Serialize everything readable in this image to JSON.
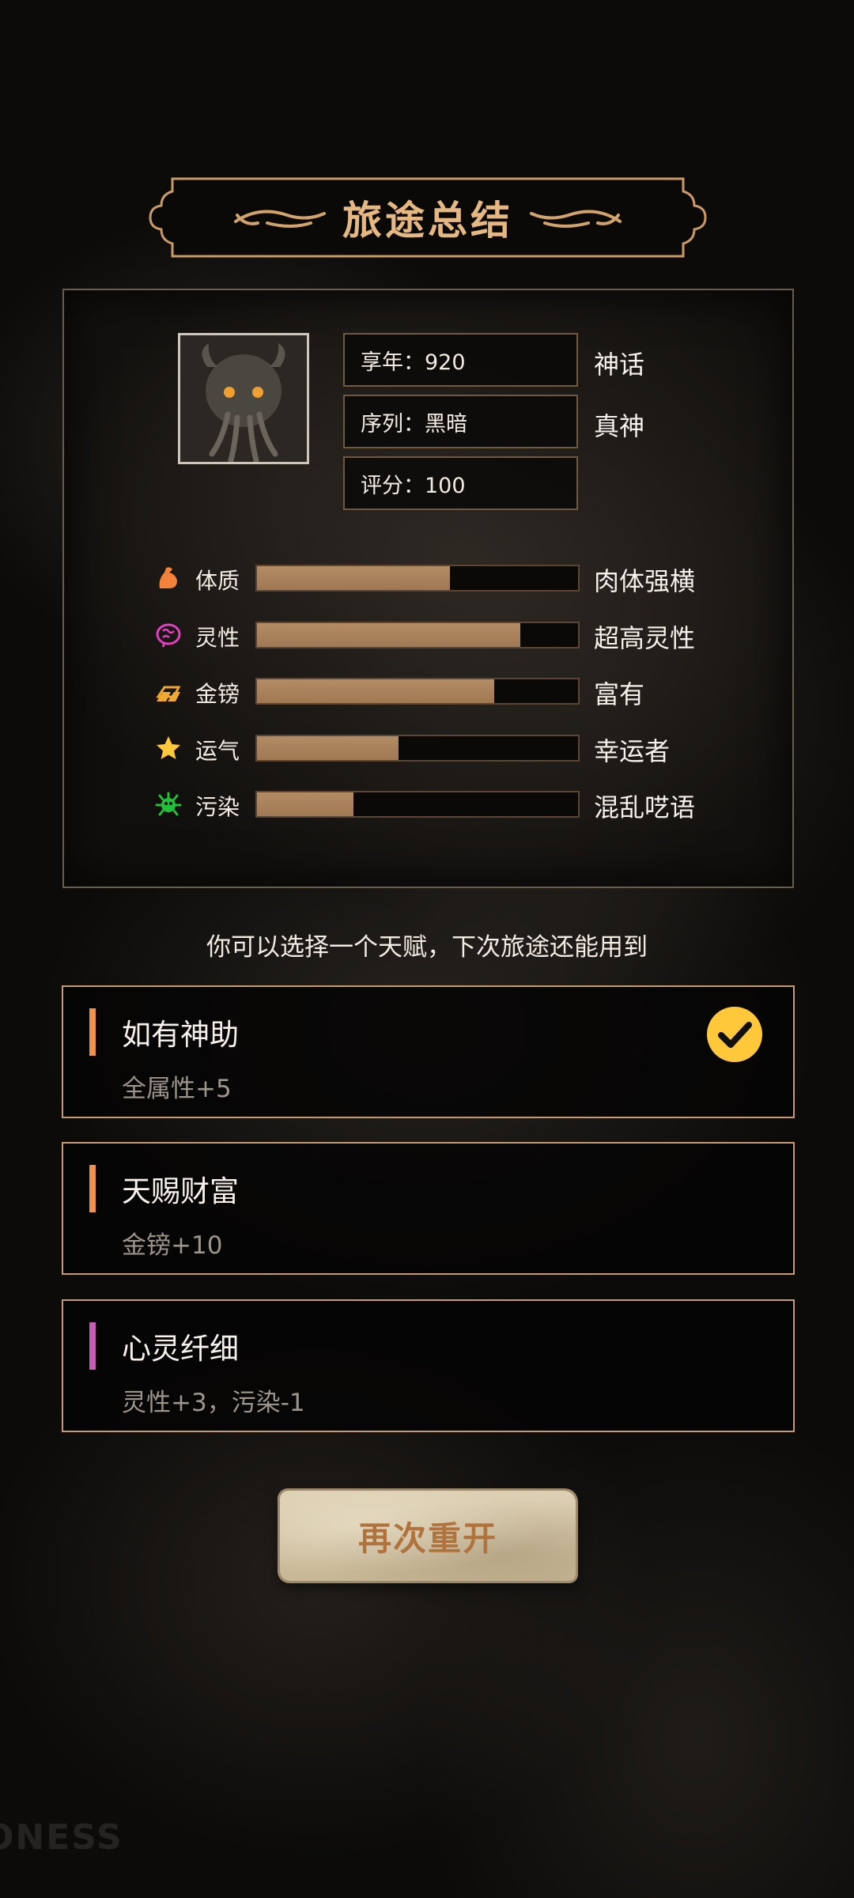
{
  "summary": {
    "title": "旅途总结",
    "info": [
      {
        "label": "享年：920",
        "tag": "神话"
      },
      {
        "label": "序列：黑暗",
        "tag": "真神"
      },
      {
        "label": "评分：100",
        "tag": ""
      }
    ],
    "stats": [
      {
        "label": "体质",
        "fill": 0.6,
        "desc": "肉体强横",
        "icon": "flexed-arm-icon",
        "color": "#f5823a"
      },
      {
        "label": "灵性",
        "fill": 0.82,
        "desc": "超高灵性",
        "icon": "brain-icon",
        "color": "#e23fc0"
      },
      {
        "label": "金镑",
        "fill": 0.74,
        "desc": "富有",
        "icon": "gold-bar-icon",
        "color": "#f0a830"
      },
      {
        "label": "运气",
        "fill": 0.44,
        "desc": "幸运者",
        "icon": "star-icon",
        "color": "#ffc83a"
      },
      {
        "label": "污染",
        "fill": 0.3,
        "desc": "混乱呓语",
        "icon": "virus-icon",
        "color": "#22c03a"
      }
    ]
  },
  "prompt": "你可以选择一个天赋，下次旅途还能用到",
  "talents": [
    {
      "name": "如有神助",
      "effect": "全属性+5",
      "accent": "#f2914a",
      "selected": true
    },
    {
      "name": "天赐财富",
      "effect": "金镑+10",
      "accent": "#f2914a",
      "selected": false
    },
    {
      "name": "心灵纤细",
      "effect": "灵性+3，污染-1",
      "accent": "#c85ab8",
      "selected": false
    }
  ],
  "restart_label": "再次重开",
  "watermark": "ONESS",
  "colors": {
    "bar_fill": "#a97f59",
    "frame": "#c89b6e",
    "title": "#e5b882",
    "check": "#ffc83a"
  }
}
